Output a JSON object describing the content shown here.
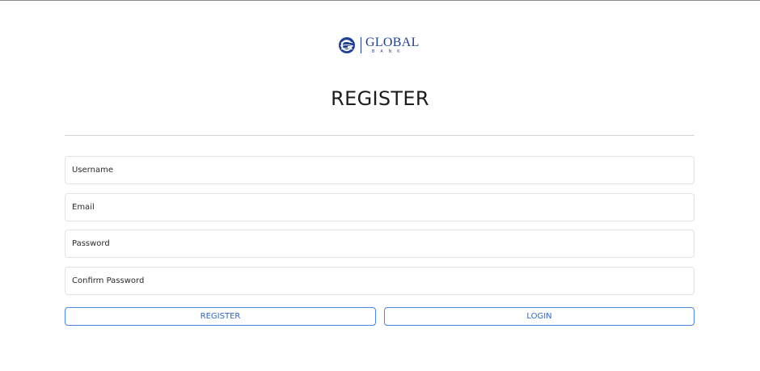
{
  "brand": {
    "name": "GLOBAL",
    "tagline": "BANK",
    "logo_icon": "globe-g-icon",
    "color": "#1f3f95"
  },
  "form": {
    "title": "REGISTER",
    "fields": {
      "username": {
        "placeholder": "Username",
        "value": ""
      },
      "email": {
        "placeholder": "Email",
        "value": ""
      },
      "password": {
        "placeholder": "Password",
        "value": ""
      },
      "confirm_password": {
        "placeholder": "Confirm Password",
        "value": ""
      }
    },
    "buttons": {
      "register": "REGISTER",
      "login": "LOGIN"
    },
    "accent_color": "#4d86e6"
  }
}
